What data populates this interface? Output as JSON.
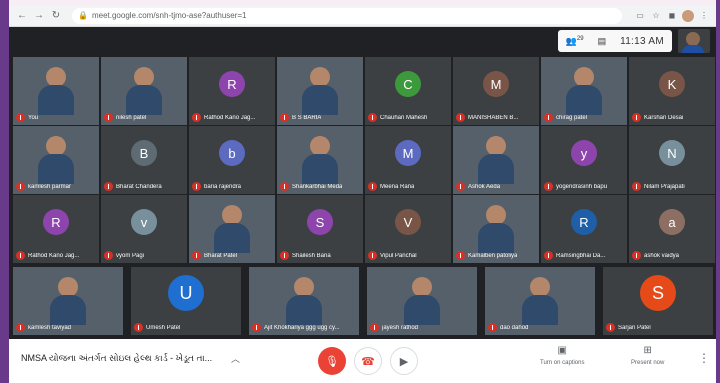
{
  "browser": {
    "url": "meet.google.com/snh-tjmo-ase?authuser=1",
    "back": "←",
    "forward": "→",
    "reload": "↻"
  },
  "topbar": {
    "participants_count": "29",
    "time": "11:13 AM"
  },
  "tiles": [
    {
      "name": "You",
      "kind": "video"
    },
    {
      "name": "nilesh patel",
      "kind": "video"
    },
    {
      "name": "Rathod Kano Jag...",
      "kind": "avatar",
      "initial": "R",
      "color": "#8e44ad"
    },
    {
      "name": "B S BARIA",
      "kind": "video"
    },
    {
      "name": "Chauhan Mahesh",
      "kind": "avatar",
      "initial": "C",
      "color": "#3c9a3c"
    },
    {
      "name": "MANISHABEN B...",
      "kind": "avatar",
      "initial": "M",
      "color": "#795548"
    },
    {
      "name": "chirag patel",
      "kind": "video"
    },
    {
      "name": "Karshan Desai",
      "kind": "avatar",
      "initial": "K",
      "color": "#795548"
    },
    {
      "name": "kamlesh parmar",
      "kind": "video"
    },
    {
      "name": "Bharat Chandera",
      "kind": "avatar",
      "initial": "B",
      "color": "#5f6b73"
    },
    {
      "name": "baria rajendra",
      "kind": "avatar",
      "initial": "b",
      "color": "#5c6bc0"
    },
    {
      "name": "Shankarbhai Meda",
      "kind": "video"
    },
    {
      "name": "Meena Rana",
      "kind": "avatar",
      "initial": "M",
      "color": "#5c6bc0"
    },
    {
      "name": "Ashok Aeda",
      "kind": "video"
    },
    {
      "name": "yogendrasinh bapu",
      "kind": "avatar",
      "initial": "y",
      "color": "#8e44ad"
    },
    {
      "name": "Nilam Prajapati",
      "kind": "avatar",
      "initial": "N",
      "color": "#78909c"
    },
    {
      "name": "Rathod Kano Jag...",
      "kind": "avatar",
      "initial": "R",
      "color": "#8e44ad"
    },
    {
      "name": "vyom Pagi",
      "kind": "avatar",
      "initial": "v",
      "color": "#78909c"
    },
    {
      "name": "Bharat Patel",
      "kind": "video"
    },
    {
      "name": "Shailesh Baria",
      "kind": "avatar",
      "initial": "S",
      "color": "#8e44ad"
    },
    {
      "name": "Vipul Panchal",
      "kind": "avatar",
      "initial": "V",
      "color": "#795548"
    },
    {
      "name": "Kamalben patoliya",
      "kind": "video"
    },
    {
      "name": "Ramsingbhai Da...",
      "kind": "avatar",
      "initial": "R",
      "color": "#1e5fa8"
    },
    {
      "name": "ashok vaidya",
      "kind": "avatar",
      "initial": "a",
      "color": "#8d6e63"
    },
    {
      "name": "kamlesh taviyad",
      "kind": "photo"
    },
    {
      "name": "Umesh Patel",
      "kind": "avatar",
      "initial": "U",
      "color": "#1e6fd0"
    },
    {
      "name": "Ajit Khokhariya ggg ugg cy...",
      "kind": "photo"
    },
    {
      "name": "jayesh rathod",
      "kind": "photo"
    },
    {
      "name": "dao dahod",
      "kind": "photo"
    },
    {
      "name": "Sarjan Patel",
      "kind": "avatar",
      "initial": "S",
      "color": "#e64a19"
    }
  ],
  "controls": {
    "meeting_title": "NMSA યોજના અંતર્ગત સોઇલ હેલ્થ કાર્ડ - ખેડૂત તા...",
    "captions_label": "Turn on captions",
    "present_label": "Present now"
  }
}
